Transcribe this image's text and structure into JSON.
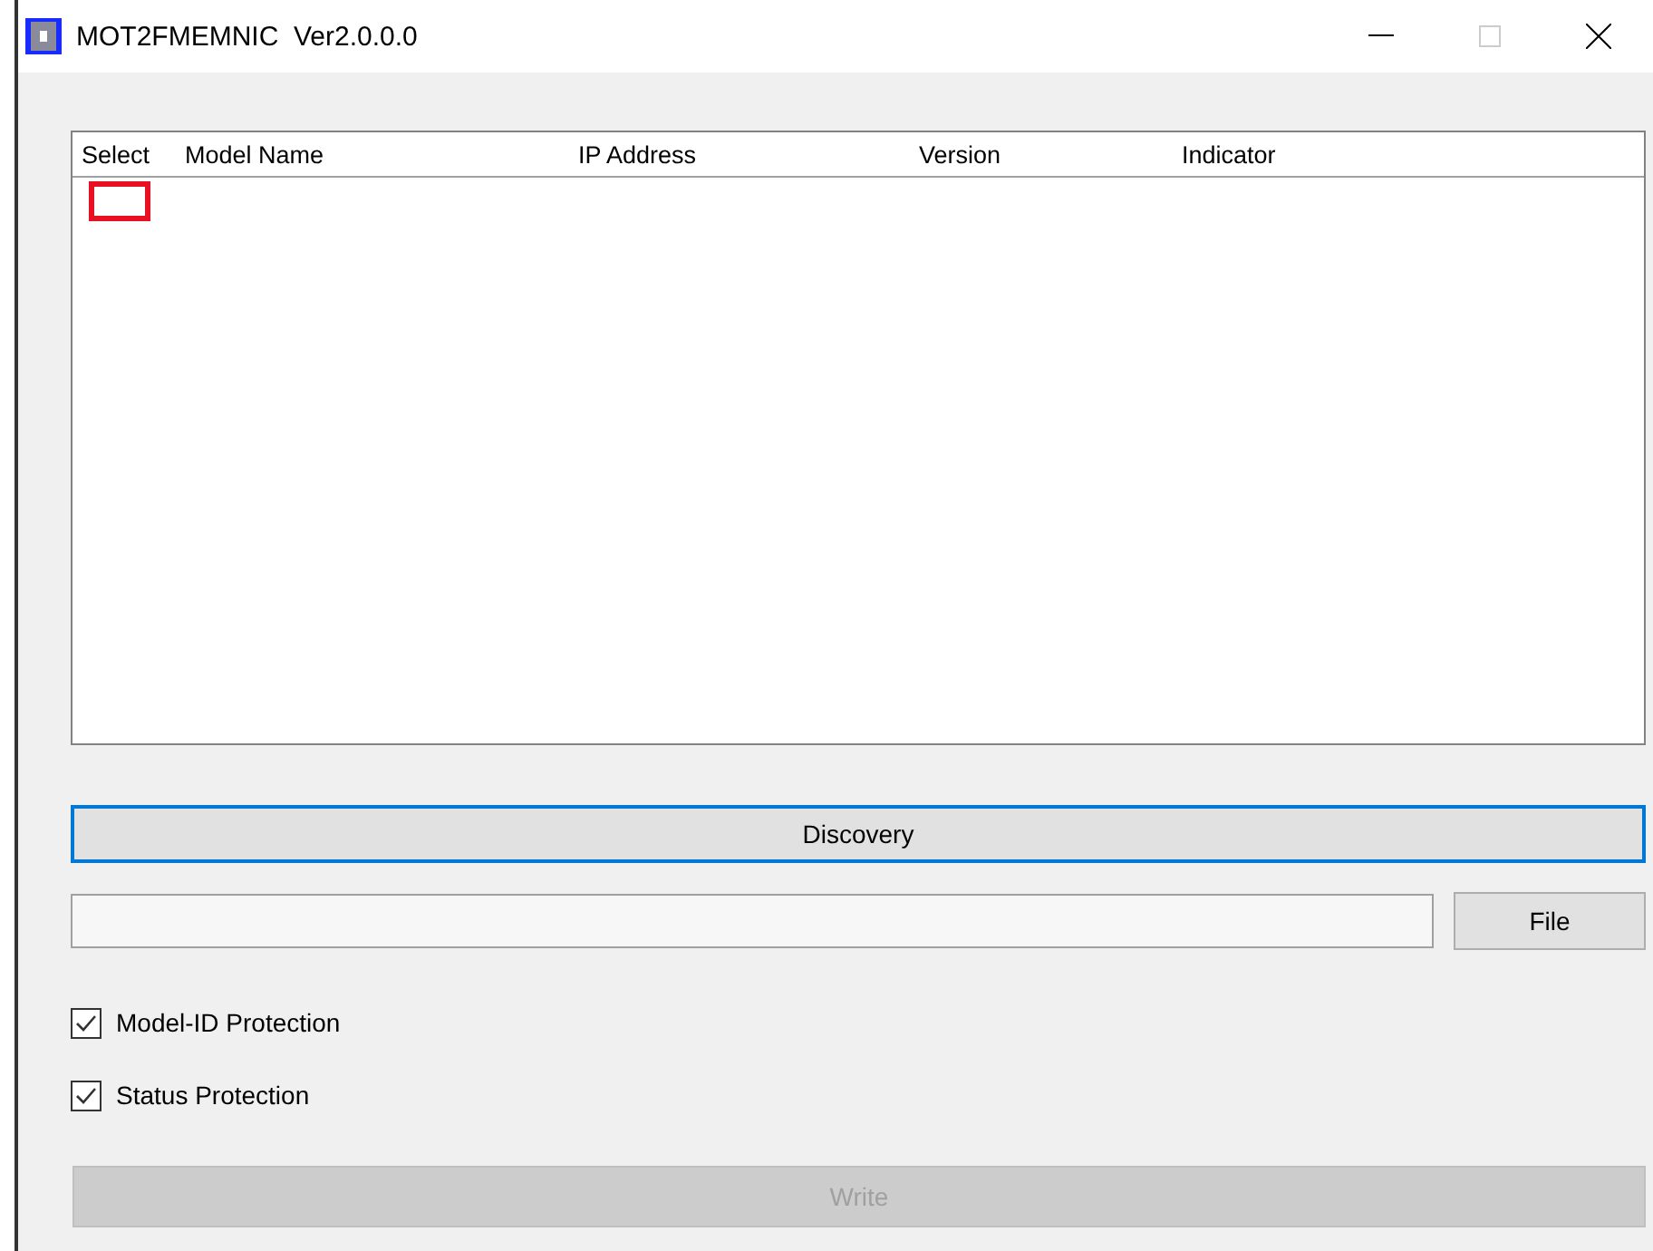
{
  "window": {
    "title": "MOT2FMEMNIC  Ver2.0.0.0",
    "maximize_disabled": true
  },
  "table": {
    "columns": [
      "Select",
      "Model Name",
      "IP Address",
      "Version",
      "Indicator"
    ],
    "cell_cursor": true
  },
  "discovery_button": {
    "label": "Discovery",
    "focused": true
  },
  "file_button": {
    "label": "File"
  },
  "checkboxes": [
    {
      "label": "Model-ID Protection",
      "checked": true
    },
    {
      "label": "Status Protection",
      "checked": true
    }
  ],
  "write_button": {
    "label": "Write",
    "disabled": true
  }
}
